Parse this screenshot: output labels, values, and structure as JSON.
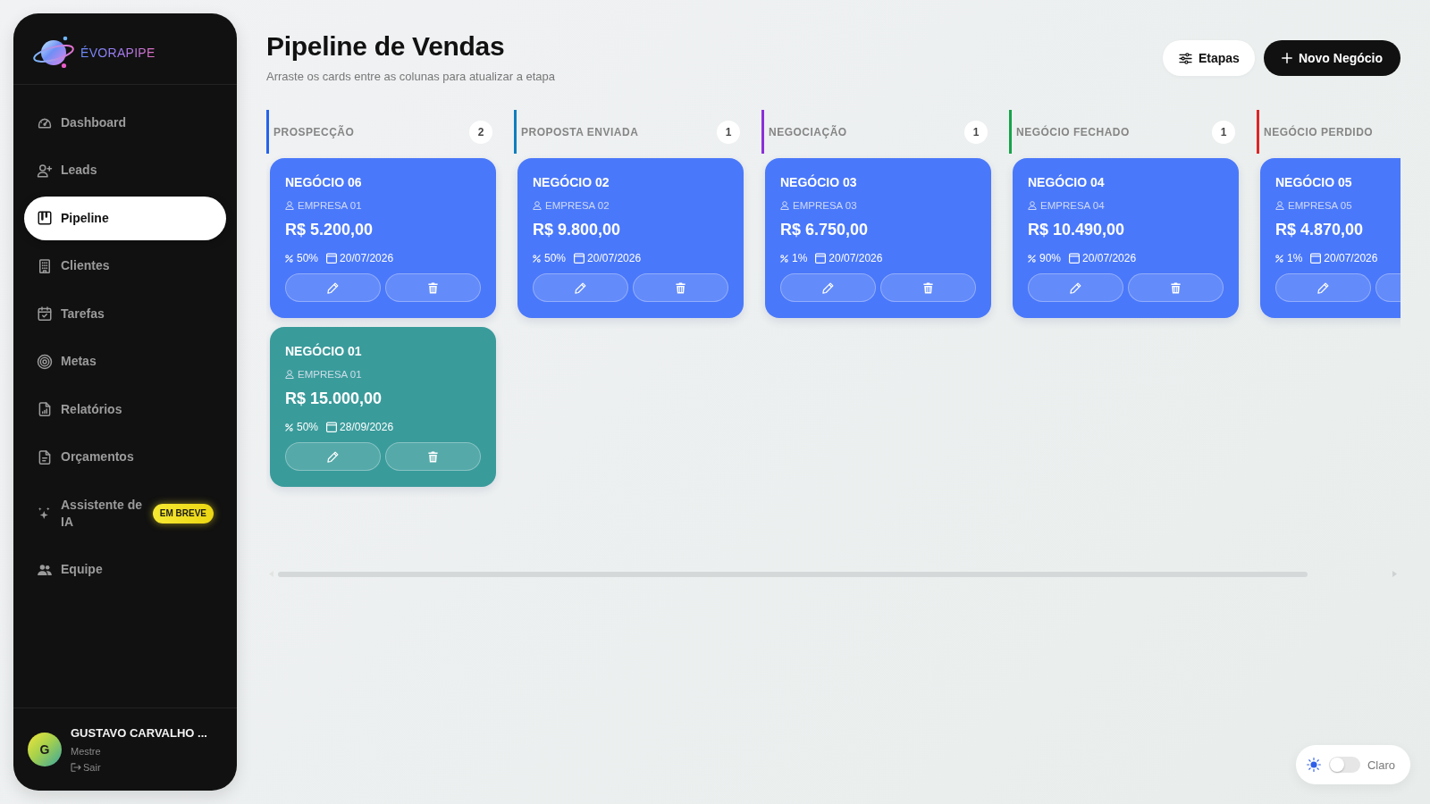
{
  "sidebar": {
    "brand": "ÉVORAPIPE",
    "nav": [
      {
        "label": "Dashboard",
        "selected": false
      },
      {
        "label": "Leads",
        "selected": false
      },
      {
        "label": "Pipeline",
        "selected": true
      },
      {
        "label": "Clientes",
        "selected": false
      },
      {
        "label": "Tarefas",
        "selected": false
      },
      {
        "label": "Metas",
        "selected": false
      },
      {
        "label": "Relatórios",
        "selected": false
      },
      {
        "label": "Orçamentos",
        "selected": false
      },
      {
        "label": "Assistente de IA",
        "selected": false,
        "badge": "EM BREVE"
      },
      {
        "label": "Equipe",
        "selected": false
      }
    ],
    "user": {
      "initial": "G",
      "name": "GUSTAVO CARVALHO ...",
      "role": "Mestre",
      "logout": "Sair"
    }
  },
  "header": {
    "title": "Pipeline de Vendas",
    "subtitle": "Arraste os cards entre as colunas para atualizar a etapa",
    "actions": [
      {
        "label": "Etapas",
        "kind": "secondary"
      },
      {
        "label": "Novo Negócio",
        "kind": "primary"
      }
    ]
  },
  "board": {
    "columns": [
      {
        "title": "PROSPECÇÃO",
        "count": "2",
        "color": "#2563eb",
        "cards": [
          {
            "title": "NEGÓCIO 06",
            "client": "EMPRESA 01",
            "value": "R$ 5.200,00",
            "probability": "50%",
            "date": "20/07/2026",
            "color": "#4a78fa"
          },
          {
            "title": "NEGÓCIO 01",
            "client": "EMPRESA 01",
            "value": "R$ 15.000,00",
            "probability": "50%",
            "date": "28/09/2026",
            "color": "#3a9b9b"
          }
        ]
      },
      {
        "title": "PROPOSTA ENVIADA",
        "count": "1",
        "color": "#0f7fbf",
        "cards": [
          {
            "title": "NEGÓCIO 02",
            "client": "EMPRESA 02",
            "value": "R$ 9.800,00",
            "probability": "50%",
            "date": "20/07/2026",
            "color": "#4a78fa"
          }
        ]
      },
      {
        "title": "NEGOCIAÇÃO",
        "count": "1",
        "color": "#8b2fd9",
        "cards": [
          {
            "title": "NEGÓCIO 03",
            "client": "EMPRESA 03",
            "value": "R$ 6.750,00",
            "probability": "1%",
            "date": "20/07/2026",
            "color": "#4a78fa"
          }
        ]
      },
      {
        "title": "NEGÓCIO FECHADO",
        "count": "1",
        "color": "#16a34a",
        "cards": [
          {
            "title": "NEGÓCIO 04",
            "client": "EMPRESA 04",
            "value": "R$ 10.490,00",
            "probability": "90%",
            "date": "20/07/2026",
            "color": "#4a78fa"
          }
        ]
      },
      {
        "title": "NEGÓCIO PERDIDO",
        "color": "#dc2626",
        "cards": [
          {
            "title": "NEGÓCIO 05",
            "client": "EMPRESA 05",
            "value": "R$ 4.870,00",
            "probability": "1%",
            "date": "20/07/2026",
            "color": "#4a78fa"
          }
        ]
      }
    ]
  },
  "theme_toggle": {
    "on": false,
    "label": "Claro"
  }
}
